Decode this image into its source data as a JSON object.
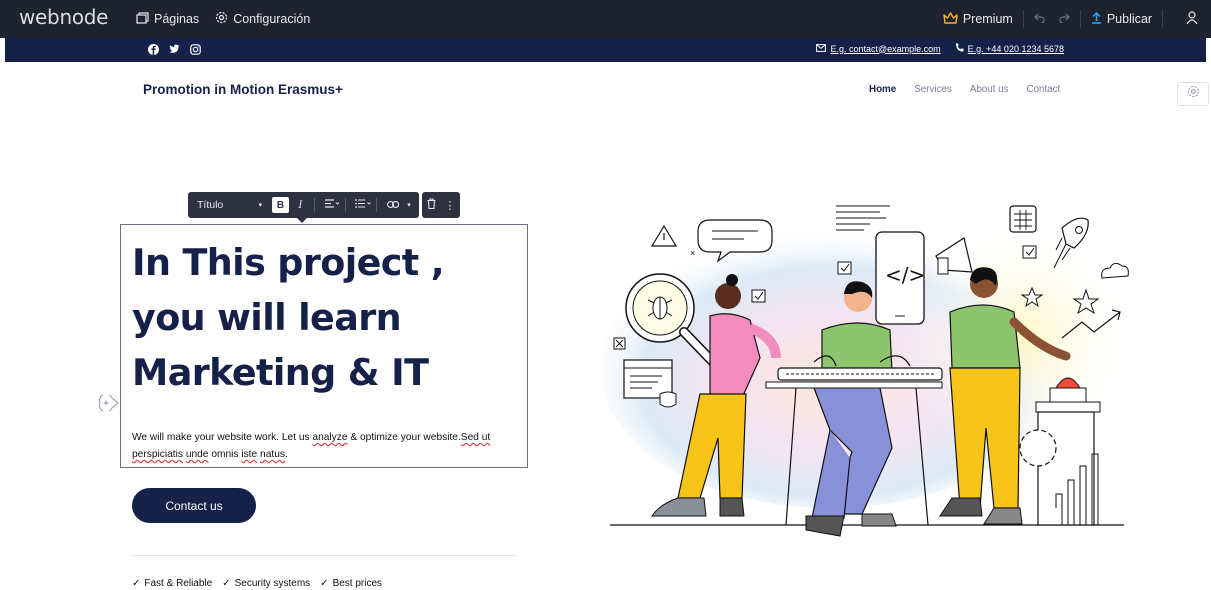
{
  "editor": {
    "logo": "webnode",
    "nav": [
      {
        "label": "Páginas",
        "icon": "pages-icon"
      },
      {
        "label": "Configuración",
        "icon": "settings-icon"
      }
    ],
    "premium_label": "Premium",
    "publish_label": "Publicar"
  },
  "contact_strip": {
    "social": [
      "facebook-icon",
      "twitter-icon",
      "instagram-icon"
    ],
    "email": "E.g. contact@example.com",
    "phone": "E.g. +44 020 1234 5678"
  },
  "site": {
    "brand": "Promotion in Motion Erasmus+",
    "nav": [
      "Home",
      "Services",
      "About us",
      "Contact"
    ],
    "active_nav": "Home"
  },
  "format_toolbar": {
    "style_value": "Título",
    "bold": "B",
    "italic": "I"
  },
  "hero": {
    "headline_lines": [
      "In This project ,",
      "you will learn",
      "Marketing & IT"
    ],
    "body_parts": [
      "We will make your website work. Let us ",
      "analyze",
      " & optimize your website.",
      "Sed ut",
      " ",
      "perspiciatis",
      " ",
      "unde",
      " omnis ",
      "iste",
      " ",
      "natus",
      "."
    ],
    "cta_label": "Contact us",
    "features": [
      "Fast & Reliable",
      "Security systems",
      "Best prices"
    ]
  },
  "colors": {
    "topbar": "#1f2330",
    "brand_navy": "#16214a",
    "premium": "#f5b324",
    "publish_accent": "#2fa3f2"
  }
}
